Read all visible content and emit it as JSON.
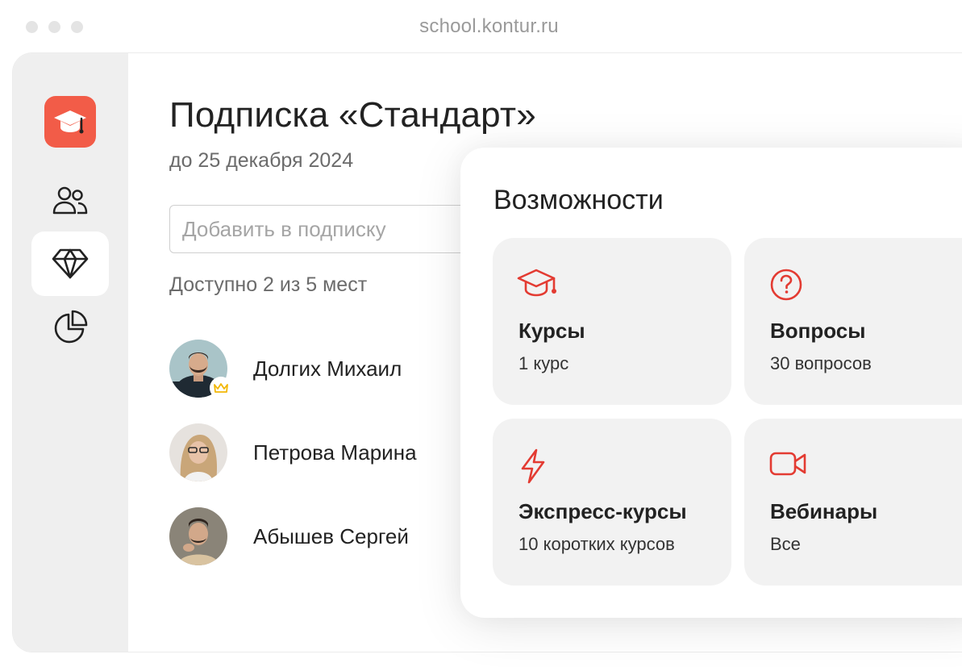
{
  "browser": {
    "url": "school.kontur.ru"
  },
  "colors": {
    "accent": "#f25c48",
    "icon_red": "#e33b32",
    "crown": "#f2b705",
    "sidebar_bg": "#efefef",
    "card_bg": "#f2f2f2"
  },
  "sidebar": {
    "logo_icon": "graduation-cap-icon",
    "items": [
      {
        "icon": "users-icon",
        "active": false
      },
      {
        "icon": "diamond-icon",
        "active": true
      },
      {
        "icon": "pie-chart-icon",
        "active": false
      }
    ]
  },
  "subscription": {
    "title": "Подписка «Стандарт»",
    "valid_until": "до 25 декабря 2024",
    "add_placeholder": "Добавить в подписку",
    "seats_text": "Доступно 2 из 5 мест",
    "members": [
      {
        "name": "Долгих Михаил",
        "owner": true,
        "owner_icon": "crown-icon"
      },
      {
        "name": "Петрова Марина",
        "owner": false
      },
      {
        "name": "Абышев Сергей",
        "owner": false
      }
    ]
  },
  "features": {
    "title": "Возможности",
    "items": [
      {
        "icon": "graduation-cap-icon",
        "title": "Курсы",
        "subtitle": "1 курс"
      },
      {
        "icon": "question-circle-icon",
        "title": "Вопросы",
        "subtitle": "30 вопросов"
      },
      {
        "icon": "lightning-icon",
        "title": "Экспресс-курсы",
        "subtitle": "10 коротких курсов"
      },
      {
        "icon": "video-camera-icon",
        "title": "Вебинары",
        "subtitle": "Все"
      }
    ]
  }
}
